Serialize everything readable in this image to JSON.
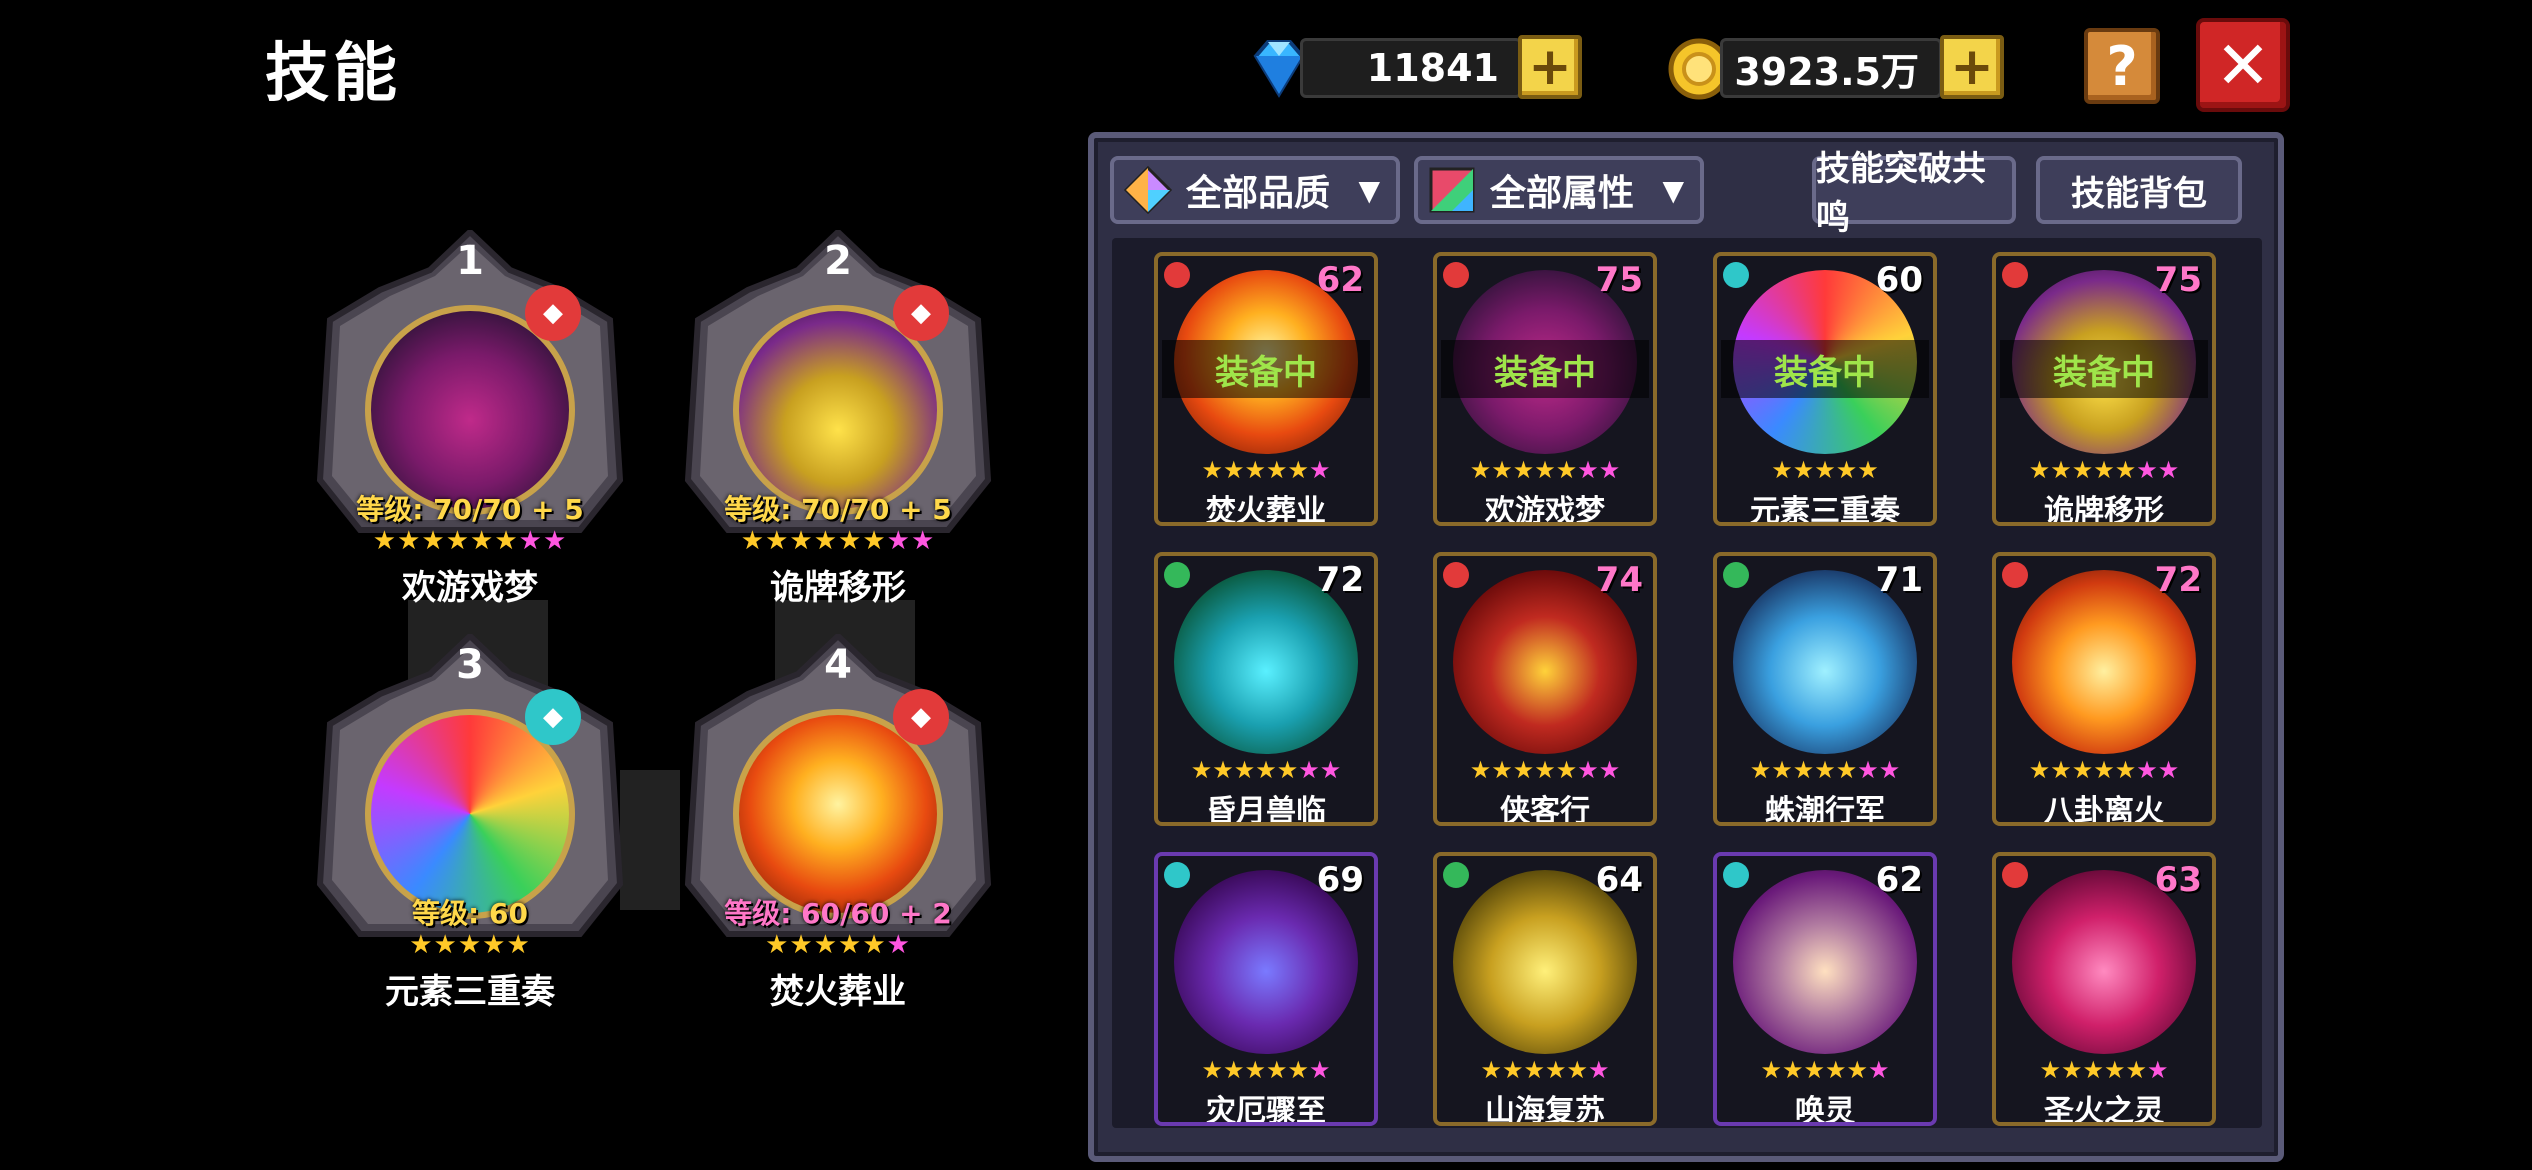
{
  "title": "技能",
  "currency": {
    "gems": "11841",
    "gold": "3923.5万",
    "plus_label": "+",
    "help_label": "?",
    "close_label": "✕"
  },
  "colors": {
    "background": "#000000",
    "panel": "#2f2f45",
    "gold_star": "#ffc928",
    "pink_star": "#ff56e0",
    "equipped_text": "#9fe54a",
    "fire_badge": "#e23a3a",
    "water_badge": "#2fc7c9",
    "wood_badge": "#34b85a"
  },
  "equipped_slots": [
    {
      "number": "1",
      "level_text": "等级: 70/70 + 5",
      "name": "欢游戏梦",
      "gold_stars": 6,
      "pink_stars": 2,
      "element": "fire"
    },
    {
      "number": "2",
      "level_text": "等级: 70/70 + 5",
      "name": "诡牌移形",
      "gold_stars": 6,
      "pink_stars": 2,
      "element": "fire"
    },
    {
      "number": "3",
      "level_text": "等级: 60",
      "name": "元素三重奏",
      "gold_stars": 5,
      "pink_stars": 0,
      "element": "water"
    },
    {
      "number": "4",
      "level_text": "等级: 60/60 + 2",
      "name": "焚火葬业",
      "gold_stars": 5,
      "pink_stars": 1,
      "element": "fire"
    }
  ],
  "filters": {
    "quality": "全部品质",
    "attribute": "全部属性",
    "resonance_button": "技能突破共鸣",
    "bag_button": "技能背包"
  },
  "equipped_label": "装备中",
  "skills": [
    {
      "name": "焚火葬业",
      "level": "62",
      "element": "fire",
      "equipped": true,
      "gold_stars": 5,
      "pink_stars": 1
    },
    {
      "name": "欢游戏梦",
      "level": "75",
      "element": "fire",
      "equipped": true,
      "gold_stars": 5,
      "pink_stars": 2
    },
    {
      "name": "元素三重奏",
      "level": "60",
      "element": "water",
      "equipped": true,
      "gold_stars": 5,
      "pink_stars": 0
    },
    {
      "name": "诡牌移形",
      "level": "75",
      "element": "fire",
      "equipped": true,
      "gold_stars": 5,
      "pink_stars": 2
    },
    {
      "name": "昏月兽临",
      "level": "72",
      "element": "wood",
      "equipped": false,
      "gold_stars": 5,
      "pink_stars": 2
    },
    {
      "name": "侠客行",
      "level": "74",
      "element": "fire",
      "equipped": false,
      "gold_stars": 5,
      "pink_stars": 2
    },
    {
      "name": "蛛潮行军",
      "level": "71",
      "element": "wood",
      "equipped": false,
      "gold_stars": 5,
      "pink_stars": 2
    },
    {
      "name": "八卦离火",
      "level": "72",
      "element": "fire",
      "equipped": false,
      "gold_stars": 5,
      "pink_stars": 2
    },
    {
      "name": "灾厄骤至",
      "level": "69",
      "element": "water",
      "equipped": false,
      "gold_stars": 5,
      "pink_stars": 1
    },
    {
      "name": "山海复苏",
      "level": "64",
      "element": "wood",
      "equipped": false,
      "gold_stars": 5,
      "pink_stars": 1
    },
    {
      "name": "唤灵",
      "level": "62",
      "element": "water",
      "equipped": false,
      "gold_stars": 5,
      "pink_stars": 1
    },
    {
      "name": "圣火之灵",
      "level": "63",
      "element": "fire",
      "equipped": false,
      "gold_stars": 5,
      "pink_stars": 1
    }
  ]
}
